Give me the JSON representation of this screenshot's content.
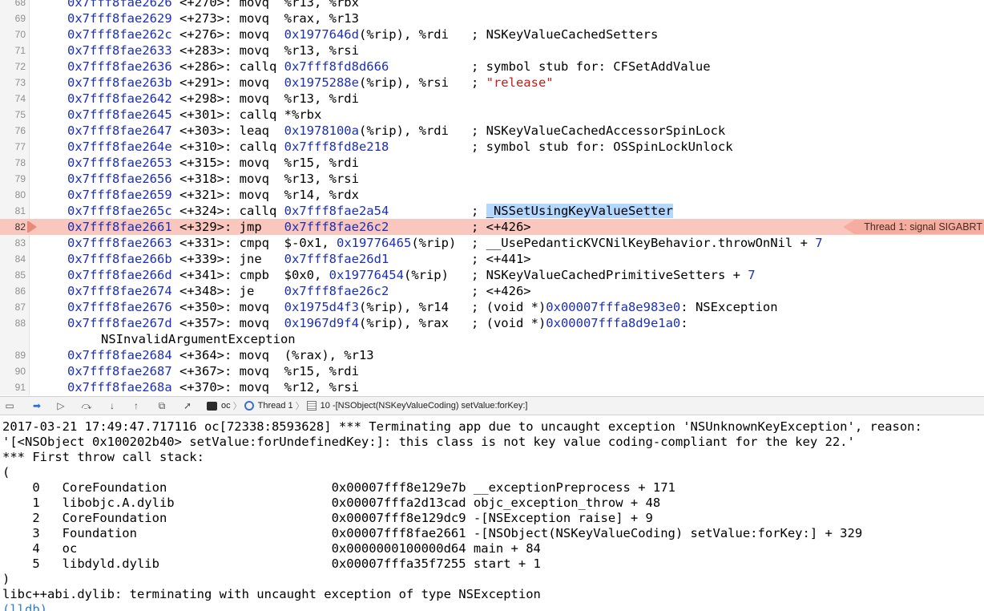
{
  "disassembly": {
    "lines": [
      {
        "ln": "68",
        "addr": "0x7fff8fae2626",
        "off": "<+270>:",
        "op": "movq",
        "args": [
          {
            "t": "%r13, %rbx",
            "c": "plain"
          }
        ],
        "comment": []
      },
      {
        "ln": "69",
        "addr": "0x7fff8fae2629",
        "off": "<+273>:",
        "op": "movq",
        "args": [
          {
            "t": "%rax, %r13",
            "c": "plain"
          }
        ],
        "comment": []
      },
      {
        "ln": "70",
        "addr": "0x7fff8fae262c",
        "off": "<+276>:",
        "op": "movq",
        "args": [
          {
            "t": "0x1977646d",
            "c": "num"
          },
          {
            "t": "(%rip), %rdi",
            "c": "plain"
          }
        ],
        "comment": [
          {
            "t": "NSKeyValueCachedSetters",
            "c": "plain"
          }
        ]
      },
      {
        "ln": "71",
        "addr": "0x7fff8fae2633",
        "off": "<+283>:",
        "op": "movq",
        "args": [
          {
            "t": "%r13, %rsi",
            "c": "plain"
          }
        ],
        "comment": []
      },
      {
        "ln": "72",
        "addr": "0x7fff8fae2636",
        "off": "<+286>:",
        "op": "callq",
        "args": [
          {
            "t": "0x7fff8fd8d666",
            "c": "num"
          }
        ],
        "comment": [
          {
            "t": "symbol stub for: CFSetAddValue",
            "c": "plain"
          }
        ]
      },
      {
        "ln": "73",
        "addr": "0x7fff8fae263b",
        "off": "<+291>:",
        "op": "movq",
        "args": [
          {
            "t": "0x1975288e",
            "c": "num"
          },
          {
            "t": "(%rip), %rsi",
            "c": "plain"
          }
        ],
        "comment": [
          {
            "t": "\"release\"",
            "c": "str"
          }
        ]
      },
      {
        "ln": "74",
        "addr": "0x7fff8fae2642",
        "off": "<+298>:",
        "op": "movq",
        "args": [
          {
            "t": "%r13, %rdi",
            "c": "plain"
          }
        ],
        "comment": []
      },
      {
        "ln": "75",
        "addr": "0x7fff8fae2645",
        "off": "<+301>:",
        "op": "callq",
        "args": [
          {
            "t": "*%rbx",
            "c": "plain"
          }
        ],
        "comment": []
      },
      {
        "ln": "76",
        "addr": "0x7fff8fae2647",
        "off": "<+303>:",
        "op": "leaq",
        "args": [
          {
            "t": "0x1978100a",
            "c": "num"
          },
          {
            "t": "(%rip), %rdi",
            "c": "plain"
          }
        ],
        "comment": [
          {
            "t": "NSKeyValueCachedAccessorSpinLock",
            "c": "plain"
          }
        ]
      },
      {
        "ln": "77",
        "addr": "0x7fff8fae264e",
        "off": "<+310>:",
        "op": "callq",
        "args": [
          {
            "t": "0x7fff8fd8e218",
            "c": "num"
          }
        ],
        "comment": [
          {
            "t": "symbol stub for: OSSpinLockUnlock",
            "c": "plain"
          }
        ]
      },
      {
        "ln": "78",
        "addr": "0x7fff8fae2653",
        "off": "<+315>:",
        "op": "movq",
        "args": [
          {
            "t": "%r15, %rdi",
            "c": "plain"
          }
        ],
        "comment": []
      },
      {
        "ln": "79",
        "addr": "0x7fff8fae2656",
        "off": "<+318>:",
        "op": "movq",
        "args": [
          {
            "t": "%r13, %rsi",
            "c": "plain"
          }
        ],
        "comment": []
      },
      {
        "ln": "80",
        "addr": "0x7fff8fae2659",
        "off": "<+321>:",
        "op": "movq",
        "args": [
          {
            "t": "%r14, %rdx",
            "c": "plain"
          }
        ],
        "comment": []
      },
      {
        "ln": "81",
        "addr": "0x7fff8fae265c",
        "off": "<+324>:",
        "op": "callq",
        "args": [
          {
            "t": "0x7fff8fae2a54",
            "c": "num"
          }
        ],
        "comment": [
          {
            "t": "_NSSetUsingKeyValueSetter",
            "c": "hl"
          }
        ]
      },
      {
        "ln": "82",
        "addr": "0x7fff8fae2661",
        "off": "<+329>:",
        "op": "jmp",
        "args": [
          {
            "t": "0x7fff8fae26c2",
            "c": "num"
          }
        ],
        "comment": [
          {
            "t": "<+426>",
            "c": "plain"
          }
        ],
        "current": true
      },
      {
        "ln": "83",
        "addr": "0x7fff8fae2663",
        "off": "<+331>:",
        "op": "cmpq",
        "args": [
          {
            "t": "$-0x1, ",
            "c": "plain"
          },
          {
            "t": "0x19776465",
            "c": "num"
          },
          {
            "t": "(%rip)",
            "c": "plain"
          }
        ],
        "comment": [
          {
            "t": "__UsePedanticKVCNilKeyBehavior.throwOnNil + ",
            "c": "plain"
          },
          {
            "t": "7",
            "c": "num"
          }
        ]
      },
      {
        "ln": "84",
        "addr": "0x7fff8fae266b",
        "off": "<+339>:",
        "op": "jne",
        "args": [
          {
            "t": "0x7fff8fae26d1",
            "c": "num"
          }
        ],
        "comment": [
          {
            "t": "<+441>",
            "c": "plain"
          }
        ]
      },
      {
        "ln": "85",
        "addr": "0x7fff8fae266d",
        "off": "<+341>:",
        "op": "cmpb",
        "args": [
          {
            "t": "$0x0, ",
            "c": "plain"
          },
          {
            "t": "0x19776454",
            "c": "num"
          },
          {
            "t": "(%rip)",
            "c": "plain"
          }
        ],
        "comment": [
          {
            "t": "NSKeyValueCachedPrimitiveSetters + ",
            "c": "plain"
          },
          {
            "t": "7",
            "c": "num"
          }
        ]
      },
      {
        "ln": "86",
        "addr": "0x7fff8fae2674",
        "off": "<+348>:",
        "op": "je",
        "args": [
          {
            "t": "0x7fff8fae26c2",
            "c": "num"
          }
        ],
        "comment": [
          {
            "t": "<+426>",
            "c": "plain"
          }
        ]
      },
      {
        "ln": "87",
        "addr": "0x7fff8fae2676",
        "off": "<+350>:",
        "op": "movq",
        "args": [
          {
            "t": "0x1975d4f3",
            "c": "num"
          },
          {
            "t": "(%rip), %r14",
            "c": "plain"
          }
        ],
        "comment": [
          {
            "t": "(void *)",
            "c": "plain"
          },
          {
            "t": "0x00007fffa8e983e0",
            "c": "num"
          },
          {
            "t": ": NSException",
            "c": "plain"
          }
        ]
      },
      {
        "ln": "88",
        "addr": "0x7fff8fae267d",
        "off": "<+357>:",
        "op": "movq",
        "args": [
          {
            "t": "0x1967d9f4",
            "c": "num"
          },
          {
            "t": "(%rip), %rax",
            "c": "plain"
          }
        ],
        "comment": [
          {
            "t": "(void *)",
            "c": "plain"
          },
          {
            "t": "0x00007fffa8d9e1a0",
            "c": "num"
          },
          {
            "t": ":",
            "c": "plain"
          }
        ]
      },
      {
        "ln": "",
        "continuation": "NSInvalidArgumentException"
      },
      {
        "ln": "89",
        "addr": "0x7fff8fae2684",
        "off": "<+364>:",
        "op": "movq",
        "args": [
          {
            "t": "(%rax), %r13",
            "c": "plain"
          }
        ],
        "comment": []
      },
      {
        "ln": "90",
        "addr": "0x7fff8fae2687",
        "off": "<+367>:",
        "op": "movq",
        "args": [
          {
            "t": "%r15, %rdi",
            "c": "plain"
          }
        ],
        "comment": []
      },
      {
        "ln": "91",
        "addr": "0x7fff8fae268a",
        "off": "<+370>:",
        "op": "movq",
        "args": [
          {
            "t": "%r12, %rsi",
            "c": "plain"
          }
        ],
        "comment": []
      }
    ],
    "signal_badge": "Thread 1: signal SIGABRT"
  },
  "debug_bar": {
    "buttons": [
      {
        "name": "hide-debug-area-button",
        "glyph": "▭"
      },
      {
        "name": "breakpoints-toggle-button",
        "glyph": "➡"
      },
      {
        "name": "continue-button",
        "glyph": "▷"
      },
      {
        "name": "step-over-button",
        "glyph": "⤼"
      },
      {
        "name": "step-into-button",
        "glyph": "↓"
      },
      {
        "name": "step-out-button",
        "glyph": "↑"
      },
      {
        "name": "debug-view-hierarchy-button",
        "glyph": "⧉"
      },
      {
        "name": "simulate-location-button",
        "glyph": "➚"
      }
    ],
    "crumb_app": "oc",
    "crumb_thread": "Thread 1",
    "crumb_frame": "10 -[NSObject(NSKeyValueCoding) setValue:forKey:]"
  },
  "console": {
    "lines": [
      "2017-03-21 17:49:47.717116 oc[72338:8593628] *** Terminating app due to uncaught exception 'NSUnknownKeyException', reason:",
      "'[<NSObject 0x100202b40> setValue:forUndefinedKey:]: this class is not key value coding-compliant for the key 22.'",
      "*** First throw call stack:",
      "(",
      "    0   CoreFoundation                      0x00007fff8e129e7b __exceptionPreprocess + 171",
      "    1   libobjc.A.dylib                     0x00007fffa2d13cad objc_exception_throw + 48",
      "    2   CoreFoundation                      0x00007fff8e129dc9 -[NSException raise] + 9",
      "    3   Foundation                          0x00007fff8fae2661 -[NSObject(NSKeyValueCoding) setValue:forKey:] + 329",
      "    4   oc                                  0x0000000100000d64 main + 84",
      "    5   libdyld.dylib                       0x00007fffa35f7255 start + 1",
      ")",
      "libc++abi.dylib: terminating with uncaught exception of type NSException"
    ],
    "prompt": "(lldb)"
  },
  "colors": {
    "address": "#1b2fb8",
    "string": "#c41a16",
    "current_line": "#f9c7bd",
    "selection": "#b3d7ff",
    "signal_badge": "#f4ad9f",
    "prompt": "#2a7bd6"
  }
}
